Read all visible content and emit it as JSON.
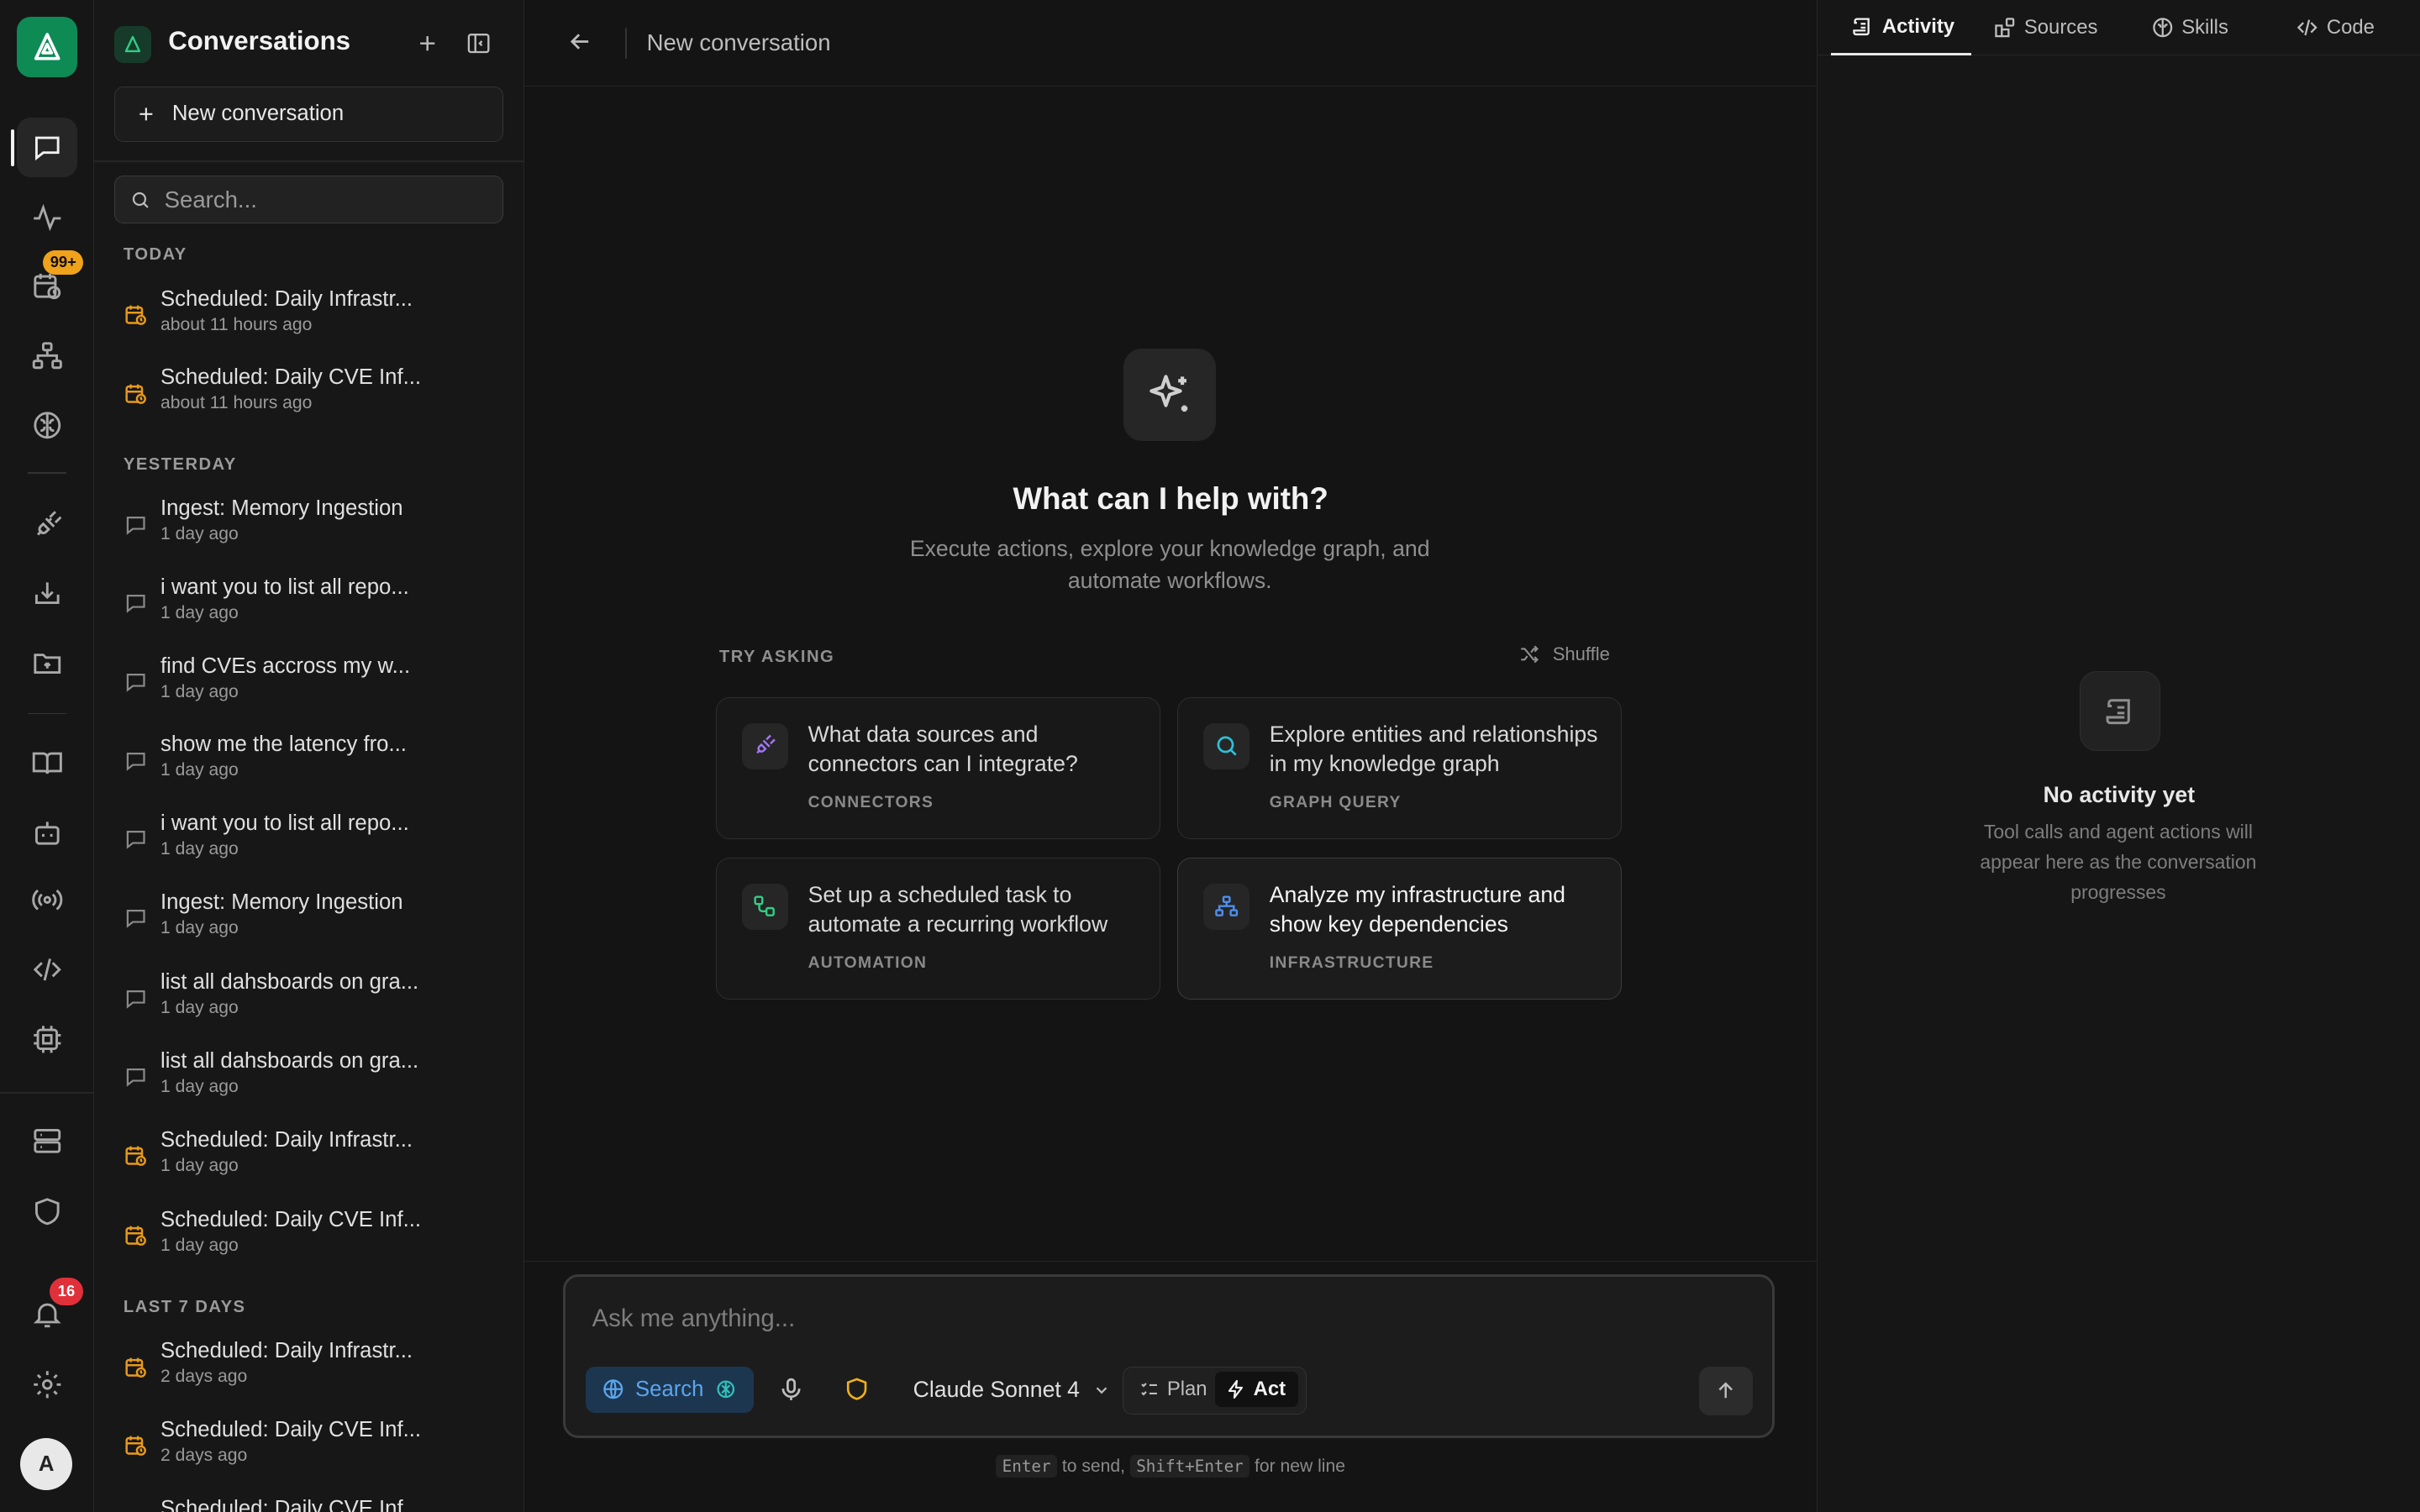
{
  "rail": {
    "schedule_badge": "99+",
    "notification_badge": "16",
    "avatar_initial": "A",
    "icons": [
      "chat-icon",
      "activity-icon",
      "schedule-icon",
      "sitemap-icon",
      "brain-icon",
      "plug-icon",
      "download-icon",
      "folder-icon",
      "book-icon",
      "bot-icon",
      "broadcast-icon",
      "code-icon",
      "cpu-icon",
      "server-icon",
      "shield-icon",
      "bell-icon",
      "gear-icon"
    ]
  },
  "sidebar": {
    "title": "Conversations",
    "new_conversation": "New conversation",
    "search_placeholder": "Search...",
    "groups": {
      "today": "TODAY",
      "yesterday": "YESTERDAY",
      "last7": "LAST 7 DAYS"
    },
    "items": [
      {
        "title": "Scheduled: Daily Infrastr...",
        "time": "about 11 hours ago",
        "kind": "scheduled"
      },
      {
        "title": "Scheduled: Daily CVE Inf...",
        "time": "about 11 hours ago",
        "kind": "scheduled"
      },
      {
        "title": "Ingest: Memory Ingestion",
        "time": "1 day ago",
        "kind": "chat"
      },
      {
        "title": "i want you to list all repo...",
        "time": "1 day ago",
        "kind": "chat"
      },
      {
        "title": "find CVEs accross my w...",
        "time": "1 day ago",
        "kind": "chat"
      },
      {
        "title": "show me the latency fro...",
        "time": "1 day ago",
        "kind": "chat"
      },
      {
        "title": "i want you to list all repo...",
        "time": "1 day ago",
        "kind": "chat"
      },
      {
        "title": "Ingest: Memory Ingestion",
        "time": "1 day ago",
        "kind": "chat"
      },
      {
        "title": "list all dahsboards on gra...",
        "time": "1 day ago",
        "kind": "chat"
      },
      {
        "title": "list all dahsboards on gra...",
        "time": "1 day ago",
        "kind": "chat"
      },
      {
        "title": "Scheduled: Daily Infrastr...",
        "time": "1 day ago",
        "kind": "scheduled"
      },
      {
        "title": "Scheduled: Daily CVE Inf...",
        "time": "1 day ago",
        "kind": "scheduled"
      },
      {
        "title": "Scheduled: Daily Infrastr...",
        "time": "2 days ago",
        "kind": "scheduled"
      },
      {
        "title": "Scheduled: Daily CVE Inf...",
        "time": "2 days ago",
        "kind": "scheduled"
      },
      {
        "title": "Scheduled: Daily CVE Inf...",
        "time": "",
        "kind": "scheduled"
      }
    ]
  },
  "main": {
    "title": "New conversation",
    "hero_title": "What can I help with?",
    "hero_subtitle": "Execute actions, explore your knowledge graph, and automate workflows.",
    "try_asking": "TRY ASKING",
    "shuffle": "Shuffle",
    "suggestions": [
      {
        "text": "What data sources and connectors can I integrate?",
        "label": "CONNECTORS",
        "icon": "plug-icon",
        "color": "#a277ee"
      },
      {
        "text": "Explore entities and relationships in my knowledge graph",
        "label": "GRAPH QUERY",
        "icon": "search-icon",
        "color": "#2fc0d8"
      },
      {
        "text": "Set up a scheduled task to automate a recurring workflow",
        "label": "AUTOMATION",
        "icon": "workflow-icon",
        "color": "#2fcf86"
      },
      {
        "text": "Analyze my infrastructure and show key dependencies",
        "label": "INFRASTRUCTURE",
        "icon": "sitemap-icon",
        "color": "#4d8fef"
      }
    ],
    "composer": {
      "placeholder": "Ask me anything...",
      "search": "Search",
      "model": "Claude Sonnet 4",
      "plan": "Plan",
      "act": "Act"
    },
    "hint": {
      "enter": "Enter",
      "to_send": "to send,",
      "shift_enter": "Shift+Enter",
      "new_line": "for new line"
    }
  },
  "right": {
    "tabs": [
      "Activity",
      "Sources",
      "Skills",
      "Code"
    ],
    "empty_title": "No activity yet",
    "empty_subtitle": "Tool calls and agent actions will appear here as the conversation progresses"
  }
}
